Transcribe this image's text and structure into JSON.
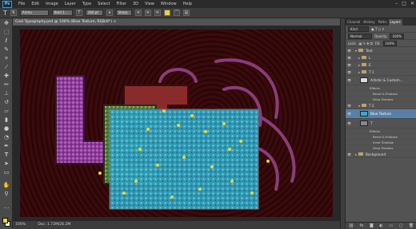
{
  "app": {
    "logo": "Ps"
  },
  "menu": [
    "File",
    "Edit",
    "Image",
    "Layer",
    "Type",
    "Select",
    "Filter",
    "3D",
    "View",
    "Window",
    "Help"
  ],
  "window_controls": [
    "–",
    "□",
    "✕"
  ],
  "options": {
    "tool_icon": "T",
    "font_family": "Arima",
    "font_style": "Bold 1...",
    "size": "260 pt",
    "antialias": "Sharp"
  },
  "document": {
    "tab_title": "Cool Typography.psd @ 100% (Blue Texture, RGB/8*) ×",
    "zoom": "100%",
    "doc_info": "Doc: 1.72M/26.2M"
  },
  "panels": {
    "tabs": [
      "Channel",
      "History",
      "Paths",
      "Layers"
    ],
    "active_tab": "Layers",
    "filter": "Kind",
    "blend_mode": "Normal",
    "opacity_label": "Opacity:",
    "opacity": "100%",
    "lock_label": "Lock:",
    "fill_label": "Fill:",
    "fill": "100%",
    "layers": [
      {
        "name": "Text",
        "kind": "group",
        "indent": 0
      },
      {
        "name": "L",
        "kind": "group",
        "indent": 1
      },
      {
        "name": "E",
        "kind": "group",
        "indent": 1
      },
      {
        "name": "T 1",
        "kind": "group",
        "indent": 1
      },
      {
        "name": "Artistic & Custom...",
        "kind": "layer",
        "indent": 1
      },
      {
        "name": "Effects",
        "kind": "fx",
        "indent": 2
      },
      {
        "name": "Bevel & Emboss",
        "kind": "fx",
        "indent": 3
      },
      {
        "name": "Drop Shadow",
        "kind": "fx",
        "indent": 3
      },
      {
        "name": "T 2",
        "kind": "group",
        "indent": 1
      },
      {
        "name": "Blue Texture",
        "kind": "layer",
        "indent": 1,
        "selected": true
      },
      {
        "name": "T",
        "kind": "layer",
        "indent": 1
      },
      {
        "name": "Effects",
        "kind": "fx",
        "indent": 2
      },
      {
        "name": "Bevel & Emboss",
        "kind": "fx",
        "indent": 3
      },
      {
        "name": "Inner Shadow",
        "kind": "fx",
        "indent": 3
      },
      {
        "name": "Drop Shadow",
        "kind": "fx",
        "indent": 3
      },
      {
        "name": "Background",
        "kind": "group",
        "indent": 0
      }
    ]
  },
  "colors": {
    "foreground": "#e8d930",
    "background": "#ffffff",
    "selection": "#5a7fa7"
  }
}
